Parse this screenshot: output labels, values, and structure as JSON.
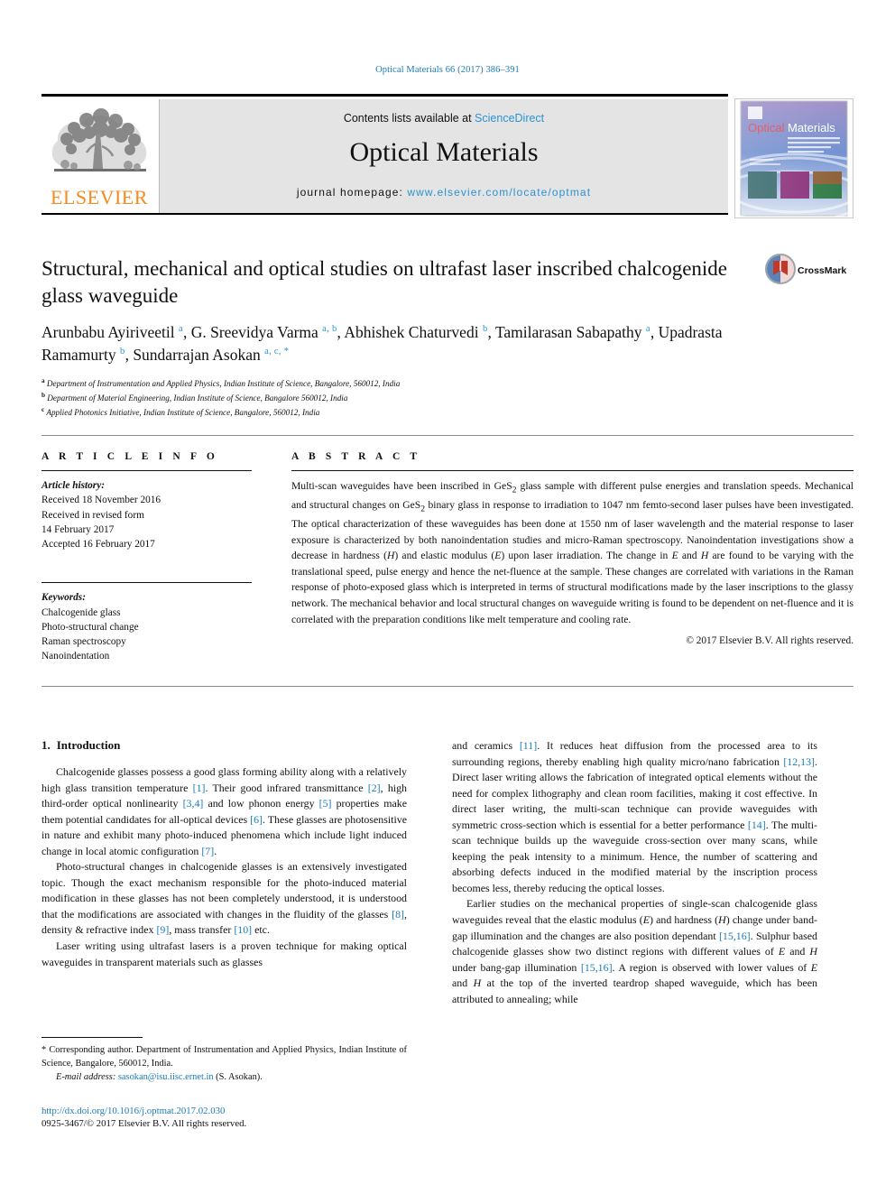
{
  "running_head": "Optical Materials 66 (2017) 386–391",
  "masthead": {
    "publisher_name": "ELSEVIER",
    "contents_prefix": "Contents lists available at ",
    "contents_link": "ScienceDirect",
    "journal_title": "Optical Materials",
    "homepage_prefix": "journal homepage: ",
    "homepage_url": "www.elsevier.com/locate/optmat",
    "cover_title_1": "Optical",
    "cover_title_2": "Materials"
  },
  "article": {
    "title": "Structural, mechanical and optical studies on ultrafast laser inscribed chalcogenide glass waveguide",
    "authors_line_1": "Arunbabu Ayiriveetil",
    "authors": [
      {
        "name": "Arunbabu Ayiriveetil",
        "marks": "a",
        "sep": ", "
      },
      {
        "name": "G. Sreevidya Varma",
        "marks": "a, b",
        "sep": ", "
      },
      {
        "name": "Abhishek Chaturvedi",
        "marks": "b",
        "sep": ", "
      },
      {
        "name": "Tamilarasan Sabapathy",
        "marks": "a",
        "sep": ", "
      },
      {
        "name": "Upadrasta Ramamurty",
        "marks": "b",
        "sep": ", "
      },
      {
        "name": "Sundarrajan Asokan",
        "marks": "a, c, *",
        "sep": ""
      }
    ],
    "affiliations": [
      {
        "mark": "a",
        "text": "Department of Instrumentation and Applied Physics, Indian Institute of Science, Bangalore, 560012, India"
      },
      {
        "mark": "b",
        "text": "Department of Material Engineering, Indian Institute of Science, Bangalore 560012, India"
      },
      {
        "mark": "c",
        "text": "Applied Photonics Initiative, Indian Institute of Science, Bangalore, 560012, India"
      }
    ],
    "crossmark_label": "CrossMark"
  },
  "article_info": {
    "heading": "A R T I C L E  I N F O",
    "history_label": "Article history:",
    "history": [
      "Received 18 November 2016",
      "Received in revised form",
      "14 February 2017",
      "Accepted 16 February 2017"
    ],
    "keywords_label": "Keywords:",
    "keywords": [
      "Chalcogenide glass",
      "Photo-structural change",
      "Raman spectroscopy",
      "Nanoindentation"
    ]
  },
  "abstract": {
    "heading": "A B S T R A C T",
    "paragraph_html": "Multi-scan waveguides have been inscribed in GeS<sub>2</sub> glass sample with different pulse energies and translation speeds. Mechanical and structural changes on GeS<sub>2</sub> binary glass in response to irradiation to 1047 nm femto-second laser pulses have been investigated. The optical characterization of these waveguides has been done at 1550 nm of laser wavelength and the material response to laser exposure is characterized by both nanoindentation studies and micro-Raman spectroscopy. Nanoindentation investigations show a decrease in hardness (<i>H</i>) and elastic modulus (<i>E</i>) upon laser irradiation. The change in <i>E</i> and <i>H</i> are found to be varying with the translational speed, pulse energy and hence the net-fluence at the sample. These changes are correlated with variations in the Raman response of photo-exposed glass which is interpreted in terms of structural modifications made by the laser inscriptions to the glassy network. The mechanical behavior and local structural changes on waveguide writing is found to be dependent on net-fluence and it is correlated with the preparation conditions like melt temperature and cooling rate.",
    "copyright": "© 2017 Elsevier B.V. All rights reserved."
  },
  "introduction": {
    "number": "1.",
    "heading": "Introduction",
    "left_paragraphs_html": [
      "Chalcogenide glasses possess a good glass forming ability along with a relatively high glass transition temperature <span class=\"ref\">[1]</span>. Their good infrared transmittance <span class=\"ref\">[2]</span>, high third-order optical nonlinearity <span class=\"ref\">[3,4]</span> and low phonon energy <span class=\"ref\">[5]</span> properties make them potential candidates for all-optical devices <span class=\"ref\">[6]</span>. These glasses are photosensitive in nature and exhibit many photo-induced phenomena which include light induced change in local atomic configuration <span class=\"ref\">[7]</span>.",
      "Photo-structural changes in chalcogenide glasses is an extensively investigated topic. Though the exact mechanism responsible for the photo-induced material modification in these glasses has not been completely understood, it is understood that the modifications are associated with changes in the fluidity of the glasses <span class=\"ref\">[8]</span>, density &amp; refractive index <span class=\"ref\">[9]</span>, mass transfer <span class=\"ref\">[10]</span> etc.",
      "Laser writing using ultrafast lasers is a proven technique for making optical waveguides in transparent materials such as glasses"
    ],
    "right_paragraphs_html": [
      "and ceramics <span class=\"ref\">[11]</span>. It reduces heat diffusion from the processed area to its surrounding regions, thereby enabling high quality micro/nano fabrication <span class=\"ref\">[12,13]</span>. Direct laser writing allows the fabrication of integrated optical elements without the need for complex lithography and clean room facilities, making it cost effective. In direct laser writing, the multi-scan technique can provide waveguides with symmetric cross-section which is essential for a better performance <span class=\"ref\">[14]</span>. The multi-scan technique builds up the waveguide cross-section over many scans, while keeping the peak intensity to a minimum. Hence, the number of scattering and absorbing defects induced in the modified material by the inscription process becomes less, thereby reducing the optical losses.",
      "Earlier studies on the mechanical properties of single-scan chalcogenide glass waveguides reveal that the elastic modulus (<i>E</i>) and hardness (<i>H</i>) change under band-gap illumination and the changes are also position dependant <span class=\"ref\">[15,16]</span>. Sulphur based chalcogenide glasses show two distinct regions with different values of <i>E</i> and <i>H</i> under bang-gap illumination <span class=\"ref\">[15,16]</span>. A region is observed with lower values of <i>E</i> and <i>H</i> at the top of the inverted teardrop shaped waveguide, which has been attributed to annealing; while"
    ],
    "right_first_is_continuation": true
  },
  "footnote": {
    "corresponding_html": "<span class=\"star\">*</span> Corresponding author. Department of Instrumentation and Applied Physics, Indian Institute of Science, Bangalore, 560012, India.",
    "email_label": "E-mail address:",
    "email": "sasokan@isu.iisc.ernet.in",
    "email_suffix": "(S. Asokan)."
  },
  "footer": {
    "doi": "http://dx.doi.org/10.1016/j.optmat.2017.02.030",
    "issn_line": "0925-3467/© 2017 Elsevier B.V. All rights reserved."
  },
  "colors": {
    "link_blue": "#1a7bb9",
    "science_direct_blue": "#2b93d1",
    "elsevier_orange": "#f68a1e",
    "band_gray": "#e4e4e4"
  }
}
